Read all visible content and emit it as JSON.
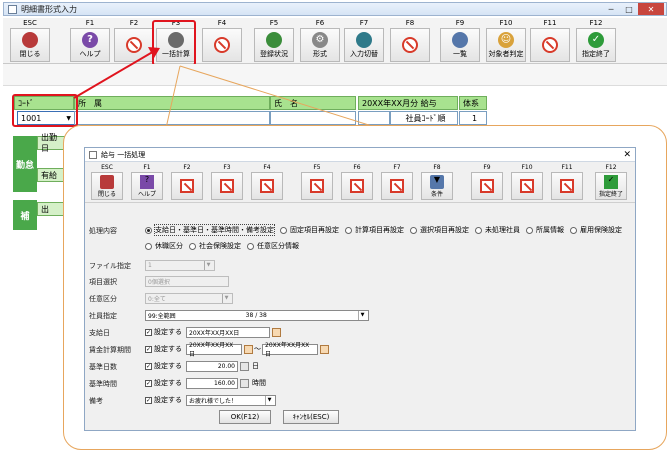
{
  "window": {
    "title": "明細書形式入力"
  },
  "fkeys": [
    {
      "key": "ESC",
      "label": "閉じる",
      "icon": "exit-icon"
    },
    {
      "key": "F1",
      "label": "ヘルプ",
      "icon": "help-icon"
    },
    {
      "key": "F2",
      "label": "",
      "icon": "disabled-icon"
    },
    {
      "key": "F3",
      "label": "一括計算",
      "icon": "calculator-icon"
    },
    {
      "key": "F4",
      "label": "",
      "icon": "disabled-icon"
    },
    {
      "key": "F5",
      "label": "登録状況",
      "icon": "register-icon"
    },
    {
      "key": "F6",
      "label": "形式",
      "icon": "gear-icon"
    },
    {
      "key": "F7",
      "label": "入力切替",
      "icon": "swap-icon"
    },
    {
      "key": "F8",
      "label": "",
      "icon": "disabled-icon"
    },
    {
      "key": "F9",
      "label": "一覧",
      "icon": "list-icon"
    },
    {
      "key": "F10",
      "label": "対象者判定",
      "icon": "people-icon"
    },
    {
      "key": "F11",
      "label": "",
      "icon": "disabled-icon"
    },
    {
      "key": "F12",
      "label": "指定終了",
      "icon": "ok-icon"
    }
  ],
  "main": {
    "code_header": "ｺｰﾄﾞ",
    "code_value": "1001",
    "dept_header": "所　属",
    "name_header": "氏　名",
    "period_header": "20XX年XX月分 給与",
    "type_header": "体系",
    "sort_label": "社員ｺｰﾄﾞ順",
    "type_value": "1",
    "band_attendance": "勤怠",
    "band_supplement": "補",
    "row1_label": "出勤日",
    "row2_label": "有給",
    "row3_label": "出"
  },
  "dialog": {
    "title": "給与 一括処理",
    "fkeys": [
      {
        "key": "ESC",
        "label": "閉じる",
        "icon": "exit-icon"
      },
      {
        "key": "F1",
        "label": "ヘルプ",
        "icon": "help-icon"
      },
      {
        "key": "F2",
        "label": "",
        "icon": "disabled-icon"
      },
      {
        "key": "F3",
        "label": "",
        "icon": "disabled-icon"
      },
      {
        "key": "F4",
        "label": "",
        "icon": "disabled-icon"
      },
      {
        "key": "F5",
        "label": "",
        "icon": "disabled-icon"
      },
      {
        "key": "F6",
        "label": "",
        "icon": "disabled-icon"
      },
      {
        "key": "F7",
        "label": "",
        "icon": "disabled-icon"
      },
      {
        "key": "F8",
        "label": "条件",
        "icon": "filter-icon"
      },
      {
        "key": "F9",
        "label": "",
        "icon": "disabled-icon"
      },
      {
        "key": "F10",
        "label": "",
        "icon": "disabled-icon"
      },
      {
        "key": "F11",
        "label": "",
        "icon": "disabled-icon"
      },
      {
        "key": "F12",
        "label": "指定終了",
        "icon": "ok-icon"
      }
    ],
    "process_label": "処理内容",
    "process_options": [
      "支給日・基準日・基準時間・備考設定",
      "固定項目再設定",
      "計算項目再設定",
      "選択項目再設定",
      "未処理社員",
      "所属情報",
      "雇用保険設定"
    ],
    "process_options2": [
      "休職区分",
      "社会保険設定",
      "任意区分情報"
    ],
    "file_label": "ファイル指定",
    "file_value": "1",
    "item_label": "項目選択",
    "item_value": "0個選択",
    "optional_label": "任意区分",
    "optional_value": "0:全て",
    "emp_label": "社員指定",
    "emp_value": "99:全範囲",
    "emp_count": "38 / 38",
    "payday_label": "支給日",
    "set_label": "設定する",
    "payday_value": "20XX年XX月XX日",
    "period_label": "賃金計算期間",
    "period_from": "20XX年XX月XX日",
    "period_sep": "～",
    "period_to": "20XX年XX月XX日",
    "days_label": "基準日数",
    "days_value": "20.00",
    "days_unit": "日",
    "hours_label": "基準時間",
    "hours_value": "160.00",
    "hours_unit": "時間",
    "note_label": "備考",
    "note_value": "お疲れ様でした！",
    "ok_button": "OK(F12)",
    "cancel_button": "ｷｬﾝｾﾙ(ESC)"
  }
}
